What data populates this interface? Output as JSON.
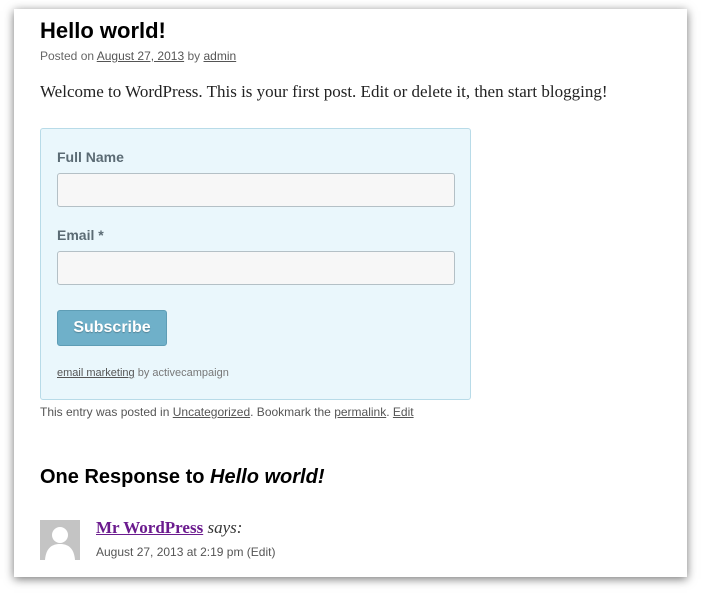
{
  "post": {
    "title": "Hello world!",
    "posted_on": "Posted on",
    "date": "August 27, 2013",
    "by": "by",
    "author": "admin",
    "body": "Welcome to WordPress. This is your first post. Edit or delete it, then start blogging!"
  },
  "form": {
    "full_name_label": "Full Name",
    "full_name_value": "",
    "email_label": "Email *",
    "email_value": "",
    "subscribe_label": "Subscribe",
    "footer_link": "email marketing",
    "footer_text": "by activecampaign"
  },
  "entry_meta": {
    "prefix": "This entry was posted in",
    "category": "Uncategorized",
    "bookmark": ". Bookmark the",
    "permalink": "permalink",
    "separator": ".",
    "edit": "Edit"
  },
  "comments": {
    "heading": "One Response to",
    "heading_post": "Hello world!",
    "items": [
      {
        "author": "Mr WordPress",
        "says": "says:",
        "datetime": "August 27, 2013 at 2:19 pm",
        "edit": "(Edit)"
      }
    ]
  }
}
